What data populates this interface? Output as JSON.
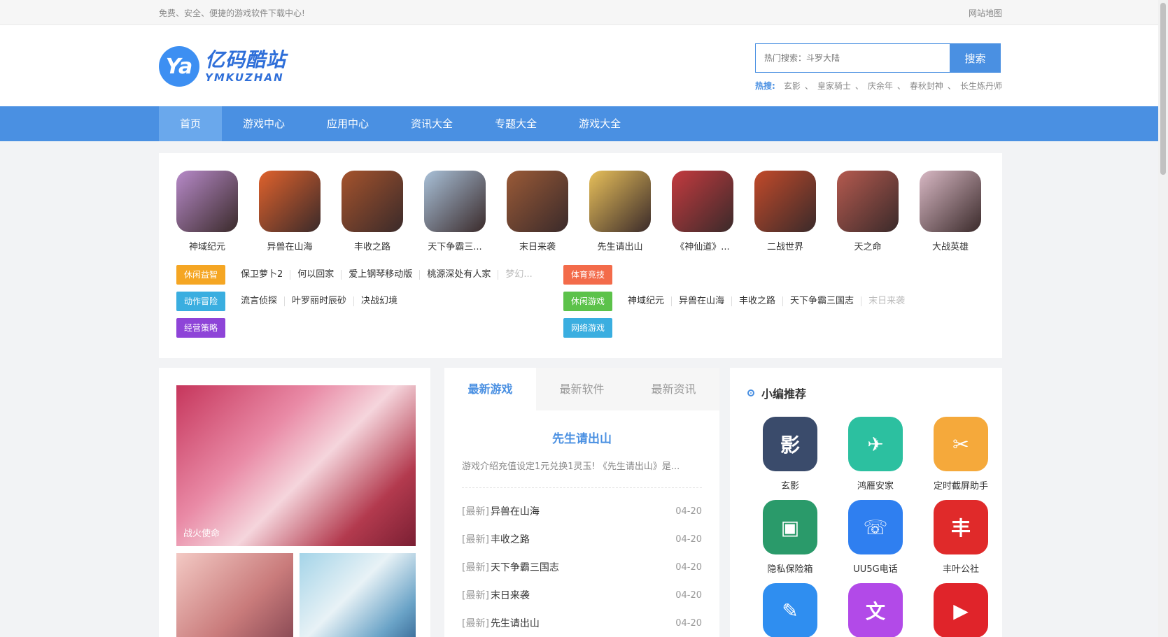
{
  "topbar": {
    "slogan": "免费、安全、便捷的游戏软件下载中心!",
    "sitemap": "网站地图"
  },
  "logo": {
    "cn": "亿码酷站",
    "en": "YMKUZHAN",
    "mark": "Ya"
  },
  "search": {
    "placeholder": "热门搜索：斗罗大陆",
    "button": "搜索"
  },
  "hot": {
    "label": "热搜:",
    "items": [
      "玄影",
      "皇家骑士",
      "庆余年",
      "春秋封神",
      "长生炼丹师"
    ]
  },
  "nav": [
    "首页",
    "游戏中心",
    "应用中心",
    "资讯大全",
    "专题大全",
    "游戏大全"
  ],
  "games": [
    {
      "name": "神域纪元",
      "color": "#b78ac9"
    },
    {
      "name": "异兽在山海",
      "color": "#e0622c"
    },
    {
      "name": "丰收之路",
      "color": "#a5532c"
    },
    {
      "name": "天下争霸三...",
      "color": "#a9c1d9"
    },
    {
      "name": "末日来袭",
      "color": "#9a5a37"
    },
    {
      "name": "先生请出山",
      "color": "#e8c05a"
    },
    {
      "name": "《神仙道》...",
      "color": "#c43a3f"
    },
    {
      "name": "二战世界",
      "color": "#c24a2a"
    },
    {
      "name": "天之命",
      "color": "#b55a4f"
    },
    {
      "name": "大战英雄",
      "color": "#d8b8c4"
    }
  ],
  "categories": {
    "left": [
      {
        "badge": "休闲益智",
        "color": "#f5a623",
        "items": [
          "保卫萝卜2",
          "何以回家",
          "爱上钢琴移动版",
          "桃源深处有人家",
          "梦幻..."
        ]
      },
      {
        "badge": "动作冒险",
        "color": "#3aaee0",
        "items": [
          "流言侦探",
          "叶罗丽时辰砂",
          "决战幻境"
        ]
      },
      {
        "badge": "经营策略",
        "color": "#8e44d8",
        "items": []
      }
    ],
    "right": [
      {
        "badge": "体育竞技",
        "color": "#f36b4a",
        "items": []
      },
      {
        "badge": "休闲游戏",
        "color": "#5cc24a",
        "items": [
          "神域纪元",
          "异兽在山海",
          "丰收之路",
          "天下争霸三国志",
          "末日来袭"
        ]
      },
      {
        "badge": "网络游戏",
        "color": "#3aaee0",
        "items": []
      }
    ]
  },
  "banner": {
    "caption": "战火使命"
  },
  "news": {
    "tabs": [
      "最新游戏",
      "最新软件",
      "最新资讯"
    ],
    "headline": "先生请出山",
    "summary": "游戏介绍充值设定1元兑换1灵玉! 《先生请出山》是...",
    "rows": [
      {
        "pre": "[最新]",
        "title": "异兽在山海",
        "date": "04-20"
      },
      {
        "pre": "[最新]",
        "title": "丰收之路",
        "date": "04-20"
      },
      {
        "pre": "[最新]",
        "title": "天下争霸三国志",
        "date": "04-20"
      },
      {
        "pre": "[最新]",
        "title": "末日来袭",
        "date": "04-20"
      },
      {
        "pre": "[最新]",
        "title": "先生请出山",
        "date": "04-20"
      }
    ]
  },
  "recommend": {
    "title": "小编推荐",
    "apps": [
      {
        "name": "玄影",
        "color": "#3a4b6b",
        "glyph": "影"
      },
      {
        "name": "鸿雁安家",
        "color": "#2cc0a0",
        "glyph": "✈"
      },
      {
        "name": "定时截屏助手",
        "color": "#f5a93b",
        "glyph": "✂"
      },
      {
        "name": "隐私保险箱",
        "color": "#2a9a6a",
        "glyph": "▣"
      },
      {
        "name": "UU5G电话",
        "color": "#2f7ff0",
        "glyph": "☏"
      },
      {
        "name": "丰叶公社",
        "color": "#e02a2a",
        "glyph": "丰"
      },
      {
        "name": "",
        "color": "#2f8ef0",
        "glyph": "✎"
      },
      {
        "name": "",
        "color": "#b24ae8",
        "glyph": "文"
      },
      {
        "name": "",
        "color": "#e0242a",
        "glyph": "▶"
      }
    ]
  }
}
